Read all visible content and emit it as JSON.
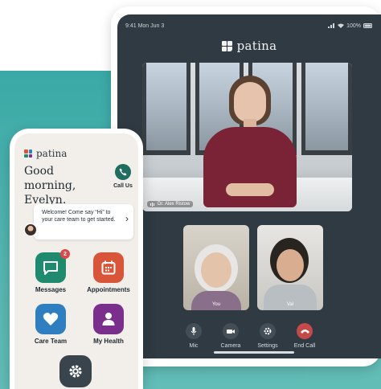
{
  "brand": {
    "name": "patina"
  },
  "tablet": {
    "status": {
      "time": "9:41 Mon Jun 3",
      "battery": "100%"
    },
    "main_video_label": "Dr. Alex Ristow",
    "tiles": [
      {
        "label": "You"
      },
      {
        "label": "Val"
      }
    ],
    "controls": [
      {
        "label": "Mic",
        "icon": "mic-icon"
      },
      {
        "label": "Camera",
        "icon": "camera-icon"
      },
      {
        "label": "Settings",
        "icon": "gear-icon"
      },
      {
        "label": "End Call",
        "icon": "phone-hangup-icon"
      }
    ],
    "colors": {
      "background": "#2f3a43",
      "end_call": "#c44a4a"
    }
  },
  "phone": {
    "greeting": "Good morning, Evelyn.",
    "call_label": "Call Us",
    "welcome_text": "Welcome! Come say “Hi” to your care team to get started.",
    "apps": [
      {
        "label": "Messages",
        "badge": "2",
        "color": "#1f8a6e",
        "icon": "chat-icon"
      },
      {
        "label": "Appointments",
        "color": "#d9553a",
        "icon": "calendar-icon"
      },
      {
        "label": "Care Team",
        "color": "#2f7fc0",
        "icon": "heart-icon"
      },
      {
        "label": "My Health",
        "color": "#7a2f8c",
        "icon": "person-icon"
      }
    ],
    "settings_icon": "gear-icon"
  }
}
